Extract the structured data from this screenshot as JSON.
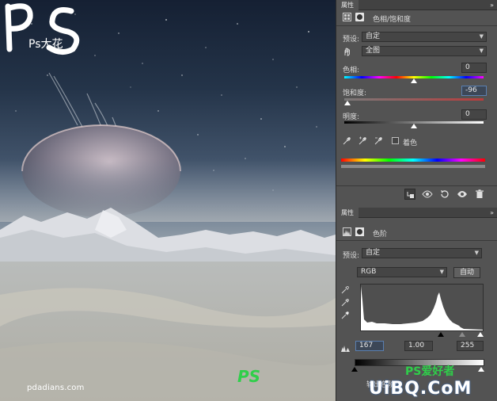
{
  "watermark": {
    "logo_text": "Ps大花",
    "site": "pdadians.com",
    "corner_brand": "UiBQ.CoM",
    "corner_brand2": "PS爱好者"
  },
  "hue_panel": {
    "tab_label": "属性",
    "panel_menu": "»",
    "title": "色相/饱和度",
    "preset_label": "预设:",
    "preset_value": "自定",
    "channel_value": "全图",
    "hue_label": "色相:",
    "hue_value": "0",
    "hue_level": 0.5,
    "saturation_label": "饱和度:",
    "saturation_value": "-96",
    "saturation_level": 0.02,
    "lightness_label": "明度:",
    "lightness_value": "0",
    "lightness_level": 0.5,
    "colorize_label": "着色",
    "colorize_checked": false,
    "footer_icons": [
      "clip-icon",
      "eye-visibility-icon",
      "reset-icon",
      "visibility-icon",
      "trash-icon"
    ]
  },
  "levels_panel": {
    "tab_label": "属性",
    "panel_menu": "»",
    "title": "色阶",
    "preset_label": "预设:",
    "preset_value": "自定",
    "channel_value": "RGB",
    "auto_label": "自动",
    "input_black": "167",
    "input_gamma": "1.00",
    "input_white": "255",
    "output_label": "输出色阶:",
    "input_black_level": 0.655,
    "input_gamma_level": 0.83,
    "input_white_level": 1.0,
    "output_black_level": 0.0,
    "output_white_level": 1.0
  },
  "colors": {
    "panel_bg": "#535353",
    "field_bg": "#454545",
    "active_border": "#5a7fb0",
    "brand_green": "#2fcf4a",
    "brand_blue": "#3a7bd5"
  }
}
